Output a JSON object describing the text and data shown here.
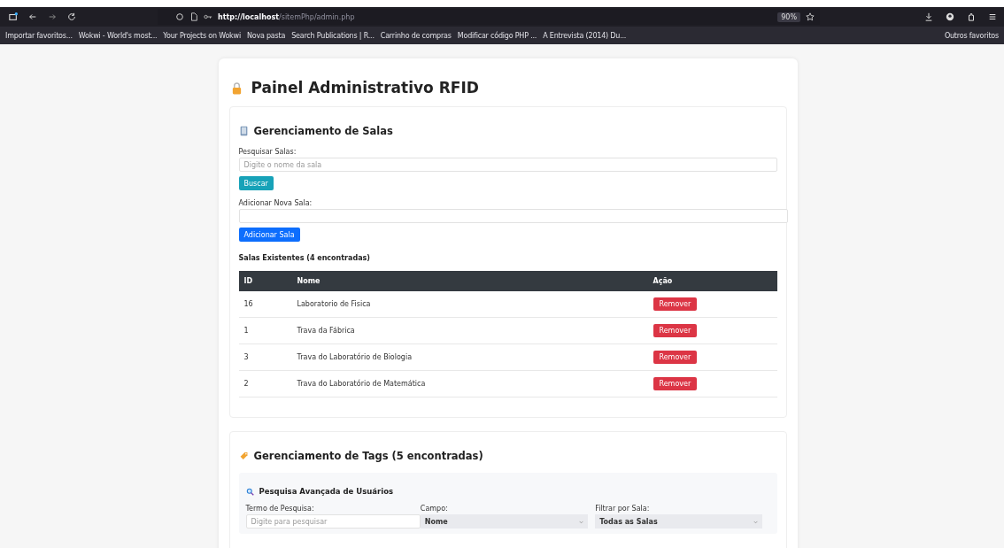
{
  "browser": {
    "url_host": "http://localhost",
    "url_path": "/sitemPhp/admin.php",
    "zoom": "90%",
    "bookmarks": [
      "Importar favoritos...",
      "Wokwi - World's most...",
      "Your Projects on Wokwi",
      "Nova pasta",
      "Search Publications | R...",
      "Carrinho de compras",
      "Modificar código PHP ...",
      "A Entrevista (2014) Du..."
    ],
    "other_bookmarks": "Outros favoritos"
  },
  "title": "Painel Administrativo RFID",
  "rooms": {
    "heading": "Gerenciamento de Salas",
    "search_label": "Pesquisar Salas:",
    "search_placeholder": "Digite o nome da sala",
    "search_button": "Buscar",
    "add_label": "Adicionar Nova Sala:",
    "add_button": "Adicionar Sala",
    "list_heading": "Salas Existentes (4 encontradas)",
    "columns": [
      "ID",
      "Nome",
      "Ação"
    ],
    "rows": [
      {
        "id": "16",
        "name": "Laboratorio de Fisica",
        "action": "Remover"
      },
      {
        "id": "1",
        "name": "Trava da Fábrica",
        "action": "Remover"
      },
      {
        "id": "3",
        "name": "Trava do Laboratório de Biologia",
        "action": "Remover"
      },
      {
        "id": "2",
        "name": "Trava do Laboratório de Matemática",
        "action": "Remover"
      }
    ]
  },
  "tags": {
    "heading": "Gerenciamento de Tags (5 encontradas)",
    "search_heading": "Pesquisa Avançada de Usuários",
    "filters": [
      {
        "kind": "text",
        "label": "Termo de Pesquisa:",
        "placeholder": "Digite para pesquisar"
      },
      {
        "kind": "select",
        "label": "Campo:",
        "value": "Nome"
      },
      {
        "kind": "select",
        "label": "Filtrar por Sala:",
        "value": "Todas as Salas"
      }
    ]
  }
}
